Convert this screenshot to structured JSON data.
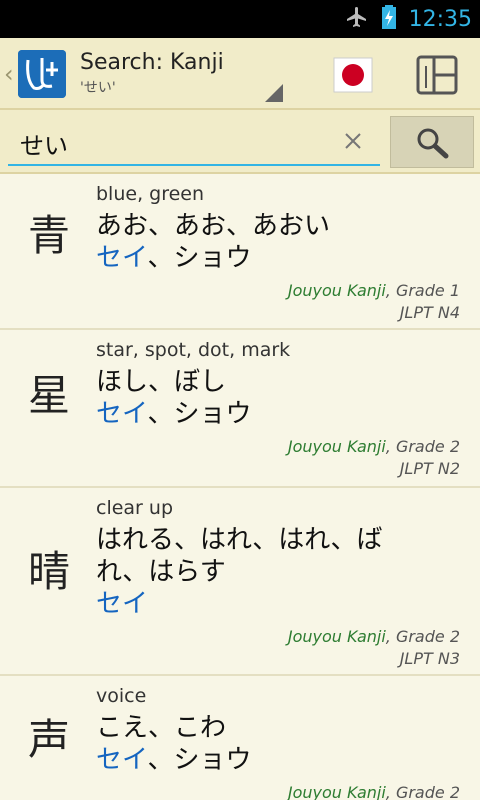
{
  "status_bar": {
    "time": "12:35",
    "icons": [
      "airplane-mode-icon",
      "battery-charging-icon"
    ]
  },
  "action_bar": {
    "title": "Search: Kanji",
    "subtitle": "'せい'",
    "up_glyph": "‹",
    "flag_icon": "japan-flag-icon",
    "layout_icon": "layout-toggle-icon"
  },
  "search": {
    "query": "せい",
    "clear_icon": "close-icon",
    "button_icon": "search-icon"
  },
  "results": [
    {
      "kanji": "青",
      "meaning": "blue, green",
      "kun_line1": "あお、あお、あおい",
      "kun_line2": "",
      "on_blue": "セイ",
      "on_rest": "、ショウ",
      "class": "Jouyou Kanji",
      "grade": ", Grade 1",
      "jlpt": "JLPT N4"
    },
    {
      "kanji": "星",
      "meaning": "star, spot, dot, mark",
      "kun_line1": "ほし、ぼし",
      "kun_line2": "",
      "on_blue": "セイ",
      "on_rest": "、ショウ",
      "class": "Jouyou Kanji",
      "grade": ", Grade 2",
      "jlpt": "JLPT N2"
    },
    {
      "kanji": "晴",
      "meaning": "clear up",
      "kun_line1": "はれる、はれ、はれ、ば",
      "kun_line2": "れ、はらす",
      "on_blue": "セイ",
      "on_rest": "",
      "class": "Jouyou Kanji",
      "grade": ", Grade 2",
      "jlpt": "JLPT N3"
    },
    {
      "kanji": "声",
      "meaning": "voice",
      "kun_line1": "こえ、こわ",
      "kun_line2": "",
      "on_blue": "セイ",
      "on_rest": "、ショウ",
      "class": "Jouyou Kanji",
      "grade": ", Grade 2",
      "jlpt": ""
    }
  ],
  "colors": {
    "accent": "#33b5e5",
    "on_reading": "#1565c0",
    "kanji_class": "#2e7d32",
    "background": "#f8f6e6",
    "bar": "#f1ecc9"
  }
}
